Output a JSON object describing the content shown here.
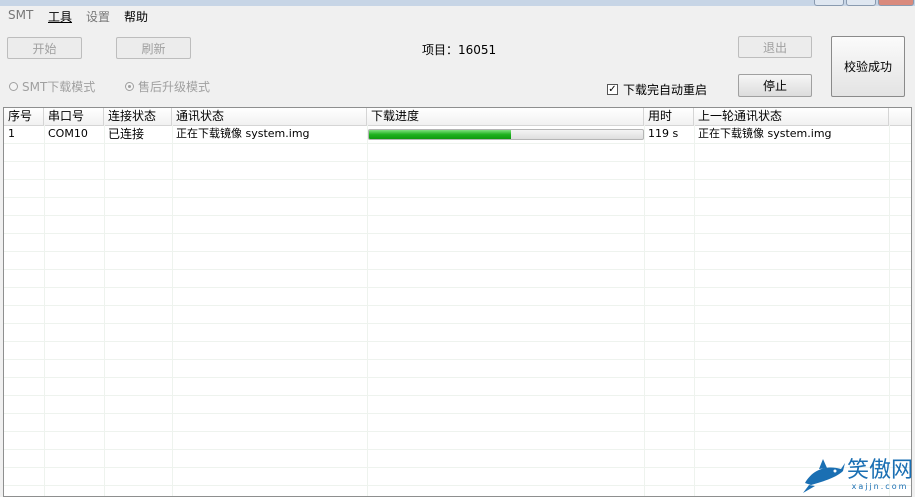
{
  "menu": {
    "items": [
      "SMT",
      "工具",
      "设置",
      "帮助"
    ]
  },
  "toolbar": {
    "start": "开始",
    "refresh": "刷新",
    "project_label": "项目：",
    "project_value": "16051",
    "exit": "退出",
    "stop": "停止",
    "verify_result": "校验成功",
    "mode_smt": "SMT下载模式",
    "mode_aftersale": "售后升级模式",
    "auto_restart_label": "下载完自动重启",
    "auto_restart_checked": true
  },
  "table": {
    "columns": [
      "序号",
      "串口号",
      "连接状态",
      "通讯状态",
      "下载进度",
      "用时",
      "上一轮通讯状态"
    ],
    "rows": [
      {
        "index": "1",
        "port": "COM10",
        "connection": "已连接",
        "comm_status": "正在下载镜像 system.img",
        "progress_fraction": 0.52,
        "elapsed": "119 s",
        "last_status": "正在下载镜像 system.img"
      }
    ]
  },
  "watermark": {
    "text": "笑傲网",
    "sub": "xajjn.com"
  },
  "colors": {
    "progress_fill": "#1fb21f",
    "disabled_text": "#a0a0a0",
    "watermark": "#1a6fb3"
  }
}
